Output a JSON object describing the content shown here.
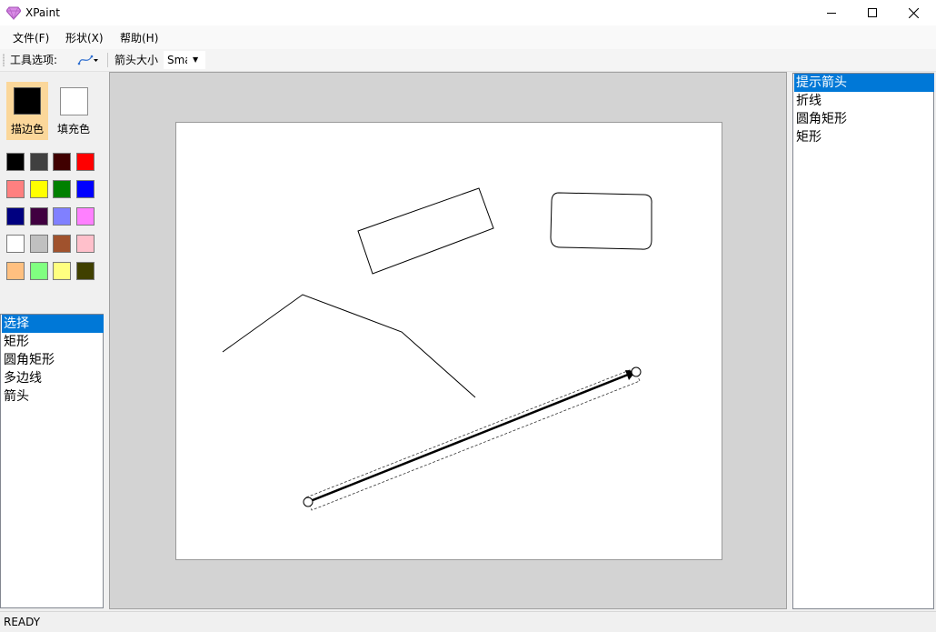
{
  "window": {
    "title": "XPaint"
  },
  "menu": {
    "file": "文件(F)",
    "shape": "形状(X)",
    "help": "帮助(H)"
  },
  "toolbar": {
    "tool_options_label": "工具选项:",
    "arrow_size_label": "箭头大小",
    "arrow_size_value": "Small"
  },
  "colors": {
    "stroke_label": "描边色",
    "fill_label": "填充色",
    "stroke": "#000000",
    "fill": "#ffffff",
    "palette": [
      "#000000",
      "#404040",
      "#400000",
      "#ff0000",
      "#ff8080",
      "#ffff00",
      "#008000",
      "#0000ff",
      "#000080",
      "#400040",
      "#8080ff",
      "#ff80ff",
      "#ffffff",
      "#c0c0c0",
      "#a0522d",
      "#ffc0cb",
      "#ffc080",
      "#80ff80",
      "#ffff80",
      "#404000"
    ]
  },
  "tools": {
    "selected_index": 0,
    "items": [
      "选择",
      "矩形",
      "圆角矩形",
      "多边线",
      "箭头"
    ]
  },
  "shapes": {
    "selected_index": 0,
    "items": [
      "提示箭头",
      "折线",
      "圆角矩形",
      "矩形"
    ]
  },
  "status": {
    "text": "READY"
  },
  "icons": {
    "app": "diamond-icon",
    "minimize": "minimize-icon",
    "maximize": "maximize-icon",
    "close": "close-icon",
    "curve_tool": "curve-tool-icon"
  }
}
